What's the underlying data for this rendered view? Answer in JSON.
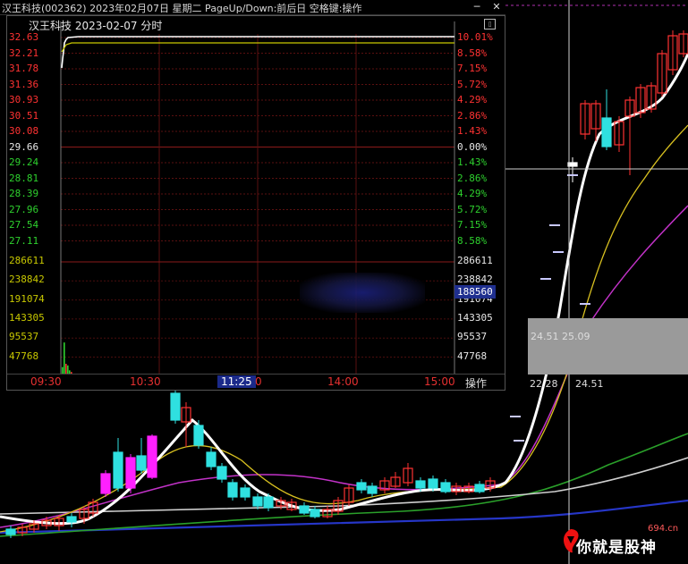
{
  "titlebar": {
    "text": "汉王科技(002362) 2023年02月07日 星期二 PageUp/Down:前后日 空格键:操作",
    "min_icon": "minimize-icon",
    "close_icon": "close-icon"
  },
  "popup": {
    "title": "汉王科技  2023-02-07  分时",
    "price_labels_left": [
      "32.63",
      "32.21",
      "31.78",
      "31.36",
      "30.93",
      "30.51",
      "30.08",
      "29.66",
      "29.24",
      "28.81",
      "28.39",
      "27.96",
      "27.54",
      "27.11"
    ],
    "pct_labels_right": [
      "10.01%",
      "8.58%",
      "7.15%",
      "5.72%",
      "4.29%",
      "2.86%",
      "1.43%",
      "0.00%",
      "1.43%",
      "2.86%",
      "4.29%",
      "5.72%",
      "7.15%",
      "8.58%"
    ],
    "vol_labels_left": [
      "286611",
      "238842",
      "191074",
      "143305",
      "95537",
      "47768"
    ],
    "vol_labels_right": [
      "286611",
      "238842",
      "191074",
      "143305",
      "95537",
      "47768"
    ],
    "vol_highlight": "188560",
    "time_labels": [
      "09:30",
      "10:30",
      "11:25",
      "0",
      "14:00",
      "15:00"
    ],
    "op_button": "操作",
    "colors": {
      "up": "#ff3232",
      "down": "#2ed12e",
      "flat": "#e8e8e8",
      "price_line": "#ffffff",
      "avg_line": "#c8c800"
    }
  },
  "crosshair": {
    "price_a": "24.51",
    "price_b": "25.09",
    "price_c": "22.28",
    "price_d": "24.51"
  },
  "watermark": {
    "text": "你就是股神",
    "site": "694.cn"
  }
}
